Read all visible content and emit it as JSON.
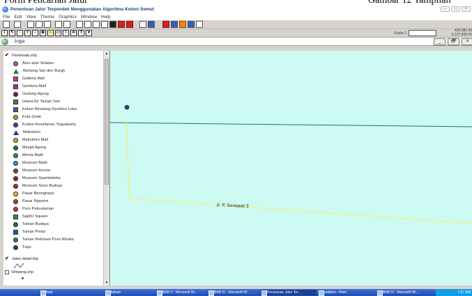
{
  "document": {
    "header_left": "Form Pencarian Jalur",
    "header_right": "Gambar 12 Tampilan"
  },
  "window": {
    "title": "Penentuan Jalur Terpendek Menggunakan Algoritma Koloni Semut",
    "menu": [
      "File",
      "Edit",
      "View",
      "Theme",
      "Graphics",
      "Window",
      "Help"
    ]
  },
  "toolbar": {
    "scale_label": "Scale 1:",
    "scale_value": "",
    "coord_x": "430,081.93",
    "coord_y": "9,127,608.55"
  },
  "view": {
    "name": "Jogja",
    "minimize": "_",
    "restore": "🗗",
    "close": "×"
  },
  "legend": {
    "themes": [
      {
        "name": "Pariwisata.shp",
        "checked": true,
        "items": [
          {
            "label": "Alun-alun Selatan",
            "color": "#cf4bd0",
            "shape": "circle"
          },
          {
            "label": "Benteng Van den Burgh",
            "color": "#2a7f2f",
            "shape": "triangle"
          },
          {
            "label": "Galleria Mall",
            "color": "#d23b7a",
            "shape": "square"
          },
          {
            "label": "Gardena Mall",
            "color": "#b5289c",
            "shape": "square"
          },
          {
            "label": "Gedung Agung",
            "color": "#4e2b83",
            "shape": "circle"
          },
          {
            "label": "Istana Air Taman Sari",
            "color": "#2d8a3e",
            "shape": "square"
          },
          {
            "label": "Kebun Binatang Gembira Loka",
            "color": "#6a4a9a",
            "shape": "square"
          },
          {
            "label": "Kota Gede",
            "color": "#d4a01e",
            "shape": "circle"
          },
          {
            "label": "Kraton Kesultanan Yogyakarta",
            "color": "#3a4a9e",
            "shape": "circle"
          },
          {
            "label": "Malioboro",
            "color": "#2a2eb0",
            "shape": "triangle-blue"
          },
          {
            "label": "Malioboro Mall",
            "color": "#e3a21b",
            "shape": "circle"
          },
          {
            "label": "Masjid Agung",
            "color": "#2c7a2c",
            "shape": "circle"
          },
          {
            "label": "Mirota Batik",
            "color": "#1c9c5a",
            "shape": "circle"
          },
          {
            "label": "Museum Batik",
            "color": "#2a9ad0",
            "shape": "circle"
          },
          {
            "label": "Museum Kereta",
            "color": "#8a4a2a",
            "shape": "circle"
          },
          {
            "label": "Museum Saamitaleka",
            "color": "#a81f2a",
            "shape": "circle"
          },
          {
            "label": "Museum Sono Budoyo",
            "color": "#b02a2a",
            "shape": "circle"
          },
          {
            "label": "Pasar Beringharjo",
            "color": "#e9c42a",
            "shape": "circle"
          },
          {
            "label": "Pasar Ngasem",
            "color": "#c8392b",
            "shape": "circle"
          },
          {
            "label": "Puro Pakualaman",
            "color": "#c0392b",
            "shape": "circle"
          },
          {
            "label": "Saphir Square",
            "color": "#2c8c3c",
            "shape": "square"
          },
          {
            "label": "Taman Budaya",
            "color": "#1c7a3a",
            "shape": "circle"
          },
          {
            "label": "Taman Pintar",
            "color": "#2e5b9e",
            "shape": "square"
          },
          {
            "label": "Taman Rekreasi Pura Wisata",
            "color": "#2a8a5a",
            "shape": "circle"
          },
          {
            "label": "Tugu",
            "color": "#3a3a8e",
            "shape": "circle"
          }
        ]
      },
      {
        "name": "Jalan detail.shp",
        "checked": true
      },
      {
        "name": "Simpang.shp",
        "checked": false
      }
    ]
  },
  "map": {
    "background": "#cefaf4",
    "road_label": "Jl. P. Senopati 3",
    "road_color": "#f2f27a",
    "line_color": "#2a6a6a"
  },
  "taskbar": {
    "items": [
      "budi",
      "tulisan",
      "BAB V - Microsoft W...",
      "BAB IV - Microsoft W...",
      "Penentuan Jalur Ter...",
      "untitled - Paint",
      "BAB IV - Microsoft W..."
    ],
    "time": "1:57 AM"
  }
}
